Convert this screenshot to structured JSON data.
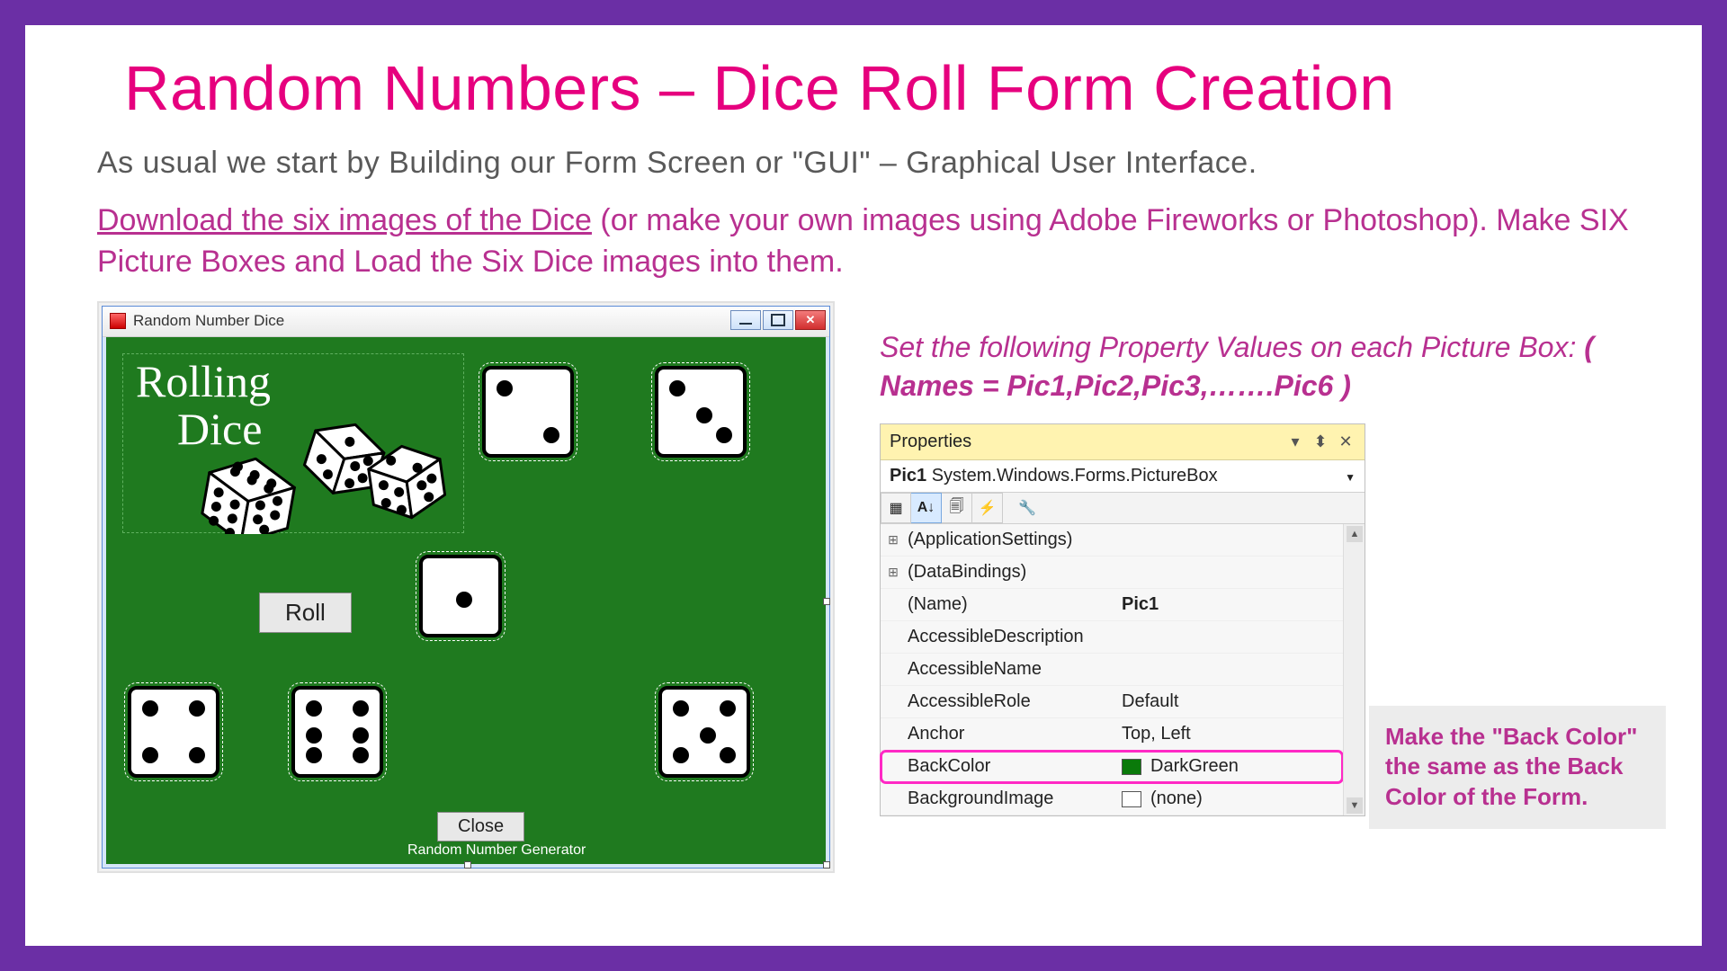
{
  "title": "Random Numbers – Dice Roll Form Creation",
  "subtitle": "As usual we start by Building our Form Screen or \"GUI\" – Graphical User Interface.",
  "instruction": {
    "link_text": "Download the six images of the Dice",
    "rest": " (or make your own images using Adobe Fireworks or Photoshop). Make SIX Picture Boxes and Load the Six Dice images into them."
  },
  "diceWindow": {
    "title": "Random Number Dice",
    "logo_line1": "Rolling",
    "logo_line2": "Dice",
    "roll_button": "Roll",
    "close_button": "Close",
    "footer": "Random Number Generator"
  },
  "rightNote": {
    "line1": "Set the following Property Values on each Picture Box:  ",
    "bold": "( Names = Pic1,Pic2,Pic3,…….Pic6 )"
  },
  "properties": {
    "panel_title": "Properties",
    "object_line_bold": "Pic1",
    "object_line_rest": " System.Windows.Forms.PictureBox",
    "rows": [
      {
        "expand": "⊞",
        "name": "(ApplicationSettings)",
        "value": ""
      },
      {
        "expand": "⊞",
        "name": "(DataBindings)",
        "value": ""
      },
      {
        "expand": "",
        "name": "(Name)",
        "value": "Pic1",
        "bold": true
      },
      {
        "expand": "",
        "name": "AccessibleDescription",
        "value": ""
      },
      {
        "expand": "",
        "name": "AccessibleName",
        "value": ""
      },
      {
        "expand": "",
        "name": "AccessibleRole",
        "value": "Default"
      },
      {
        "expand": "",
        "name": "Anchor",
        "value": "Top, Left"
      },
      {
        "expand": "",
        "name": "BackColor",
        "value": "DarkGreen",
        "swatch": "#0a7a0a",
        "highlight": true
      },
      {
        "expand": "",
        "name": "BackgroundImage",
        "value": "(none)",
        "swatch": "#ffffff"
      }
    ]
  },
  "callout": "Make the \"Back Color\" the same as the Back Color of the Form."
}
